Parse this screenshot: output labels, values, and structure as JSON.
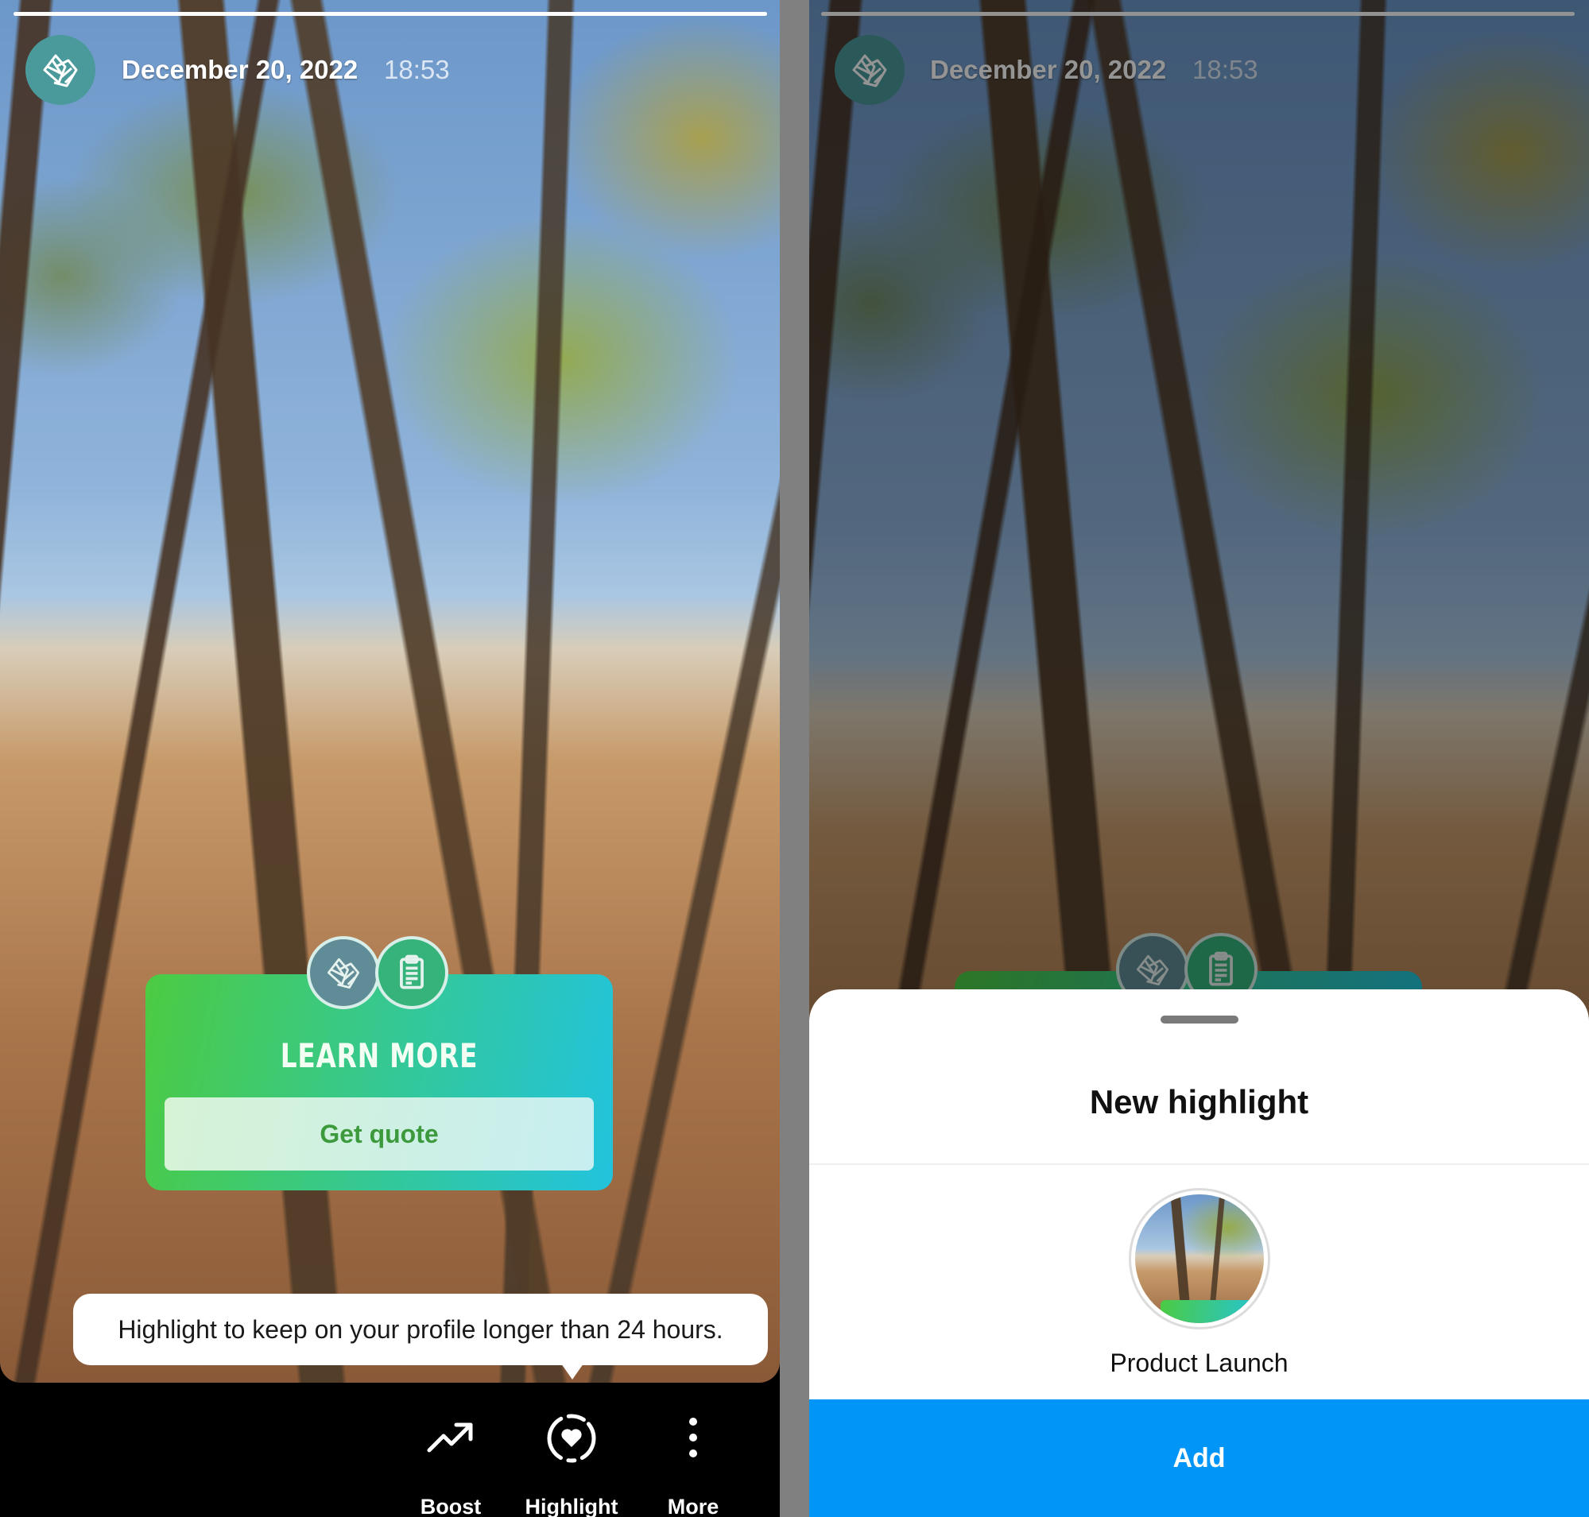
{
  "colors": {
    "avatar_bg": "#4a9a9c",
    "sticker_gradient_start": "#4ccb42",
    "sticker_gradient_end": "#22c3de",
    "sticker_button_text": "#3c9a3c",
    "primary_button": "#0095f6",
    "action_bar_bg": "#000000",
    "divider": "#808080"
  },
  "left_screen": {
    "story_progress": 1.0,
    "header": {
      "avatar_icon": "leaf-logo-icon",
      "date": "December 20, 2022",
      "time": "18:53"
    },
    "sticker": {
      "icons": [
        "leaf-logo-icon",
        "clipboard-icon"
      ],
      "title": "LEARN MORE",
      "button_label": "Get quote"
    },
    "tooltip": "Highlight to keep on your profile longer than 24 hours.",
    "actions": [
      {
        "icon": "trending-up-icon",
        "label": "Boost"
      },
      {
        "icon": "highlight-heart-icon",
        "label": "Highlight"
      },
      {
        "icon": "more-vertical-icon",
        "label": "More"
      }
    ]
  },
  "right_screen": {
    "story_progress": 1.0,
    "header": {
      "avatar_icon": "leaf-logo-icon",
      "date": "December 20, 2022",
      "time": "18:53"
    },
    "sheet": {
      "title": "New highlight",
      "highlight_name": "Product Launch",
      "add_label": "Add"
    }
  }
}
